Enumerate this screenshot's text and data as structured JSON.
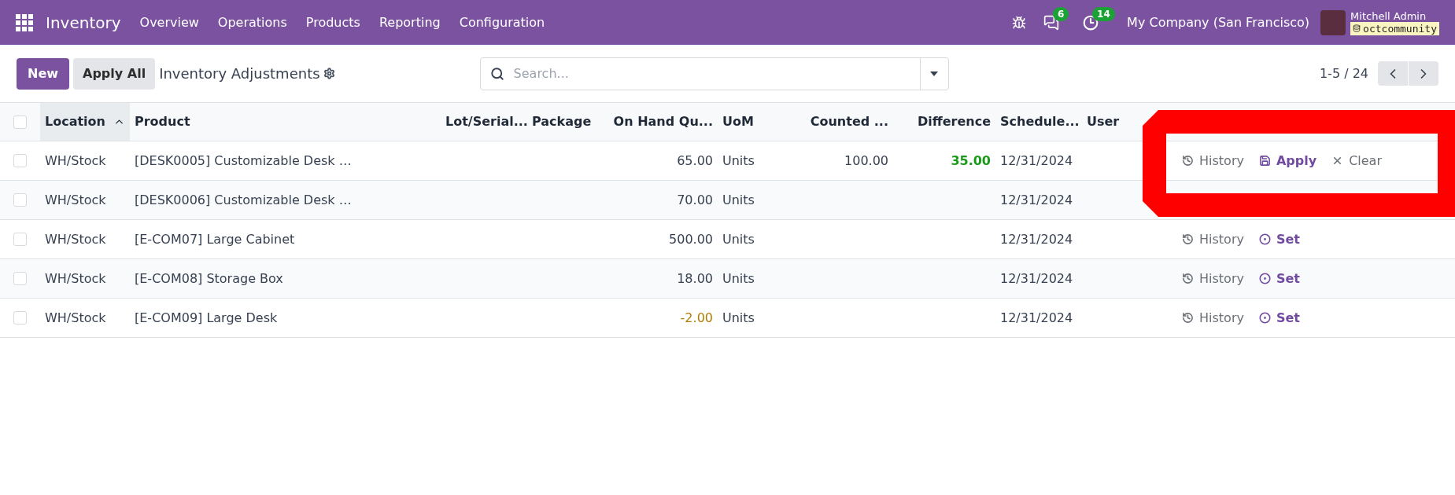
{
  "navbar": {
    "app_name": "Inventory",
    "menu": [
      "Overview",
      "Operations",
      "Products",
      "Reporting",
      "Configuration"
    ],
    "messages_count": "6",
    "activities_count": "14",
    "company": "My Company (San Francisco)",
    "user_name": "Mitchell Admin",
    "database": "octcommunity"
  },
  "control_panel": {
    "new_button": "New",
    "apply_all_button": "Apply All",
    "breadcrumb": "Inventory Adjustments",
    "search_placeholder": "Search...",
    "pager": "1-5 / 24"
  },
  "table": {
    "all_checked": false,
    "columns": [
      {
        "label": "Location",
        "sorted": true
      },
      {
        "label": "Product",
        "sorted": false
      },
      {
        "label": "Lot/Serial...",
        "sorted": false
      },
      {
        "label": "Package",
        "sorted": false
      },
      {
        "label": "On Hand Qu...",
        "sorted": false
      },
      {
        "label": "UoM",
        "sorted": false
      },
      {
        "label": "Counted ...",
        "sorted": false
      },
      {
        "label": "Difference",
        "sorted": false
      },
      {
        "label": "Schedule...",
        "sorted": false
      },
      {
        "label": "User",
        "sorted": false
      }
    ],
    "rows": [
      {
        "checked": false,
        "location": "WH/Stock",
        "product": "[DESK0005] Customizable Desk …",
        "on_hand": "65.00",
        "on_hand_negative": false,
        "uom": "Units",
        "counted": "100.00",
        "difference": "35.00",
        "difference_positive": true,
        "scheduled": "12/31/2024",
        "actions": [
          {
            "kind": "history",
            "label": "History"
          },
          {
            "kind": "apply",
            "label": "Apply"
          },
          {
            "kind": "clear",
            "label": "Clear"
          }
        ]
      },
      {
        "checked": false,
        "location": "WH/Stock",
        "product": "[DESK0006] Customizable Desk …",
        "on_hand": "70.00",
        "on_hand_negative": false,
        "uom": "Units",
        "scheduled": "12/31/2024",
        "actions": []
      },
      {
        "checked": false,
        "location": "WH/Stock",
        "product": "[E-COM07] Large Cabinet",
        "on_hand": "500.00",
        "on_hand_negative": false,
        "uom": "Units",
        "scheduled": "12/31/2024",
        "actions": [
          {
            "kind": "history",
            "label": "History"
          },
          {
            "kind": "set",
            "label": "Set"
          }
        ]
      },
      {
        "checked": false,
        "location": "WH/Stock",
        "product": "[E-COM08] Storage Box",
        "on_hand": "18.00",
        "on_hand_negative": false,
        "uom": "Units",
        "scheduled": "12/31/2024",
        "actions": [
          {
            "kind": "history",
            "label": "History"
          },
          {
            "kind": "set",
            "label": "Set"
          }
        ]
      },
      {
        "checked": false,
        "location": "WH/Stock",
        "product": "[E-COM09] Large Desk",
        "on_hand": "-2.00",
        "on_hand_negative": true,
        "uom": "Units",
        "scheduled": "12/31/2024",
        "actions": [
          {
            "kind": "history",
            "label": "History"
          },
          {
            "kind": "set",
            "label": "Set"
          }
        ]
      }
    ]
  }
}
